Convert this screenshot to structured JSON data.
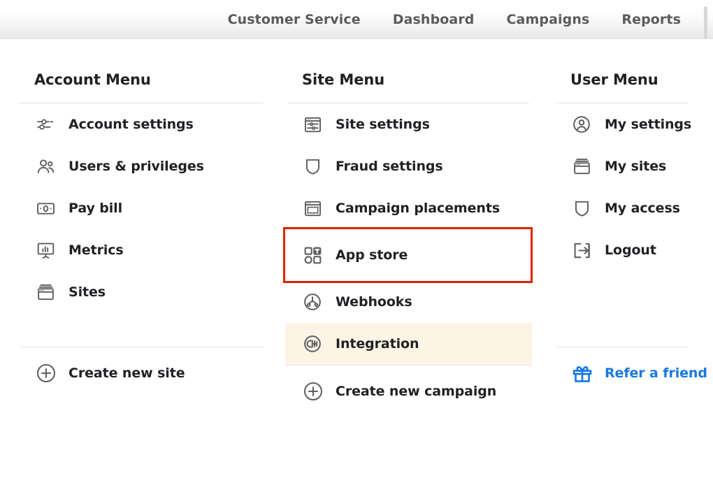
{
  "topnav": {
    "items": [
      {
        "label": "Customer Service",
        "name": "nav-customer-service"
      },
      {
        "label": "Dashboard",
        "name": "nav-dashboard"
      },
      {
        "label": "Campaigns",
        "name": "nav-campaigns"
      },
      {
        "label": "Reports",
        "name": "nav-reports"
      }
    ]
  },
  "colors": {
    "accent_link": "#1779e0",
    "highlight_row": "#fcf4e4",
    "focus_outline": "#e02200",
    "icon": "#5e5e5e",
    "text": "#1f2124",
    "nav_text": "#5b5b5b",
    "divider": "#e3e3e3"
  },
  "columns": {
    "account": {
      "title": "Account Menu",
      "items": [
        {
          "label": "Account settings",
          "icon": "sliders-icon"
        },
        {
          "label": "Users & privileges",
          "icon": "users-icon"
        },
        {
          "label": "Pay bill",
          "icon": "banknote-icon"
        },
        {
          "label": "Metrics",
          "icon": "presentation-chart-icon"
        },
        {
          "label": "Sites",
          "icon": "browser-window-icon"
        }
      ],
      "action": {
        "label": "Create new site",
        "icon": "plus-circle-icon"
      }
    },
    "site": {
      "title": "Site Menu",
      "items": [
        {
          "label": "Site settings",
          "icon": "browser-sliders-icon",
          "state": ""
        },
        {
          "label": "Fraud settings",
          "icon": "shield-icon",
          "state": ""
        },
        {
          "label": "Campaign placements",
          "icon": "browser-placement-icon",
          "state": ""
        },
        {
          "label": "App store",
          "icon": "app-grid-icon",
          "state": "outlined"
        },
        {
          "label": "Webhooks",
          "icon": "webhook-icon",
          "state": ""
        },
        {
          "label": "Integration",
          "icon": "plug-icon",
          "state": "highlight"
        }
      ],
      "action": {
        "label": "Create new campaign",
        "icon": "plus-circle-icon"
      }
    },
    "user": {
      "title": "User Menu",
      "items": [
        {
          "label": "My settings",
          "icon": "user-circle-icon"
        },
        {
          "label": "My sites",
          "icon": "browser-window-icon"
        },
        {
          "label": "My access",
          "icon": "shield-icon"
        },
        {
          "label": "Logout",
          "icon": "logout-arrow-icon"
        }
      ],
      "action": {
        "label": "Refer a friend",
        "icon": "gift-icon"
      }
    }
  }
}
